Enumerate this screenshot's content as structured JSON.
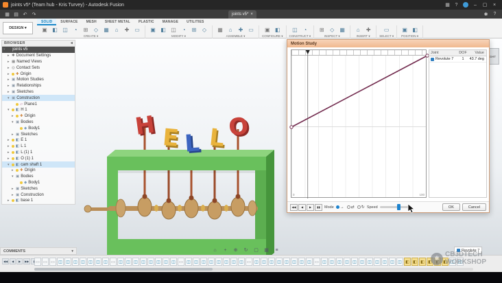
{
  "window": {
    "title": "joints v5* (Team hub - Kris Turvey) - Autodesk Fusion",
    "right_icons": [
      "▦",
      "?"
    ],
    "controls": {
      "minimize": "–",
      "maximize": "▢",
      "close": "×"
    }
  },
  "topbar": {
    "left_icons": [
      "▦",
      "▤",
      "↶",
      "↷"
    ],
    "tab": {
      "label": "joints v5*",
      "close": "×"
    },
    "right_icons": [
      "✱",
      "?"
    ]
  },
  "ribbon": {
    "design_label": "DESIGN ▾",
    "tabs": [
      {
        "label": "SOLID",
        "active": true
      },
      {
        "label": "SURFACE",
        "active": false
      },
      {
        "label": "MESH",
        "active": false
      },
      {
        "label": "SHEET METAL",
        "active": false
      },
      {
        "label": "PLASTIC",
        "active": false
      },
      {
        "label": "MANAGE",
        "active": false
      },
      {
        "label": "UTILITIES",
        "active": false
      }
    ],
    "groups": [
      {
        "label": "CREATE",
        "icons": 10
      },
      {
        "label": "MODIFY",
        "icons": 6
      },
      {
        "label": "ASSEMBLE",
        "icons": 4
      },
      {
        "label": "CONFIGURE",
        "icons": 2
      },
      {
        "label": "CONSTRUCT",
        "icons": 2
      },
      {
        "label": "INSPECT",
        "icons": 3
      },
      {
        "label": "INSERT",
        "icons": 2
      },
      {
        "label": "SELECT",
        "icons": 1
      },
      {
        "label": "POSITION",
        "icons": 2
      }
    ]
  },
  "browser": {
    "header": "BROWSER",
    "tree": [
      {
        "label": "joints v5",
        "d": 0,
        "t": "doc",
        "c": 2,
        "sel": "dark"
      },
      {
        "label": "Document Settings",
        "d": 1,
        "t": "gear",
        "c": 1
      },
      {
        "label": "Named Views",
        "d": 1,
        "t": "views",
        "c": 1
      },
      {
        "label": "Contact Sets",
        "d": 1,
        "t": "contact",
        "c": 1
      },
      {
        "label": "Origin",
        "d": 1,
        "t": "origin",
        "c": 1,
        "b": 1
      },
      {
        "label": "Motion Studies",
        "d": 1,
        "t": "folder",
        "c": 1
      },
      {
        "label": "Relationships",
        "d": 1,
        "t": "folder",
        "c": 1
      },
      {
        "label": "Sketches",
        "d": 1,
        "t": "folder",
        "c": 1
      },
      {
        "label": "Construction",
        "d": 1,
        "t": "folder",
        "c": 2,
        "sel": "blue"
      },
      {
        "label": "Plane1",
        "d": 2,
        "t": "plane",
        "c": 0,
        "b": 1
      },
      {
        "label": "H 1",
        "d": 1,
        "t": "comp",
        "c": 2,
        "b": 1
      },
      {
        "label": "Origin",
        "d": 2,
        "t": "origin",
        "c": 1,
        "b": 1
      },
      {
        "label": "Bodies",
        "d": 2,
        "t": "folder",
        "c": 2
      },
      {
        "label": "Body1",
        "d": 3,
        "t": "body",
        "c": 0,
        "b": 1
      },
      {
        "label": "Sketches",
        "d": 2,
        "t": "folder",
        "c": 1
      },
      {
        "label": "E 1",
        "d": 1,
        "t": "comp",
        "c": 1,
        "b": 1
      },
      {
        "label": "L 1",
        "d": 1,
        "t": "comp",
        "c": 1,
        "b": 1
      },
      {
        "label": "L (1) 1",
        "d": 1,
        "t": "comp",
        "c": 1,
        "b": 1
      },
      {
        "label": "O (1) 1",
        "d": 1,
        "t": "comp",
        "c": 1,
        "b": 1
      },
      {
        "label": "cam shaft 1",
        "d": 1,
        "t": "comp",
        "c": 2,
        "b": 1,
        "sel": "blue"
      },
      {
        "label": "Origin",
        "d": 2,
        "t": "origin",
        "c": 1,
        "b": 1
      },
      {
        "label": "Bodies",
        "d": 2,
        "t": "folder",
        "c": 2
      },
      {
        "label": "Body1",
        "d": 3,
        "t": "body",
        "c": 0,
        "b": 1
      },
      {
        "label": "Sketches",
        "d": 2,
        "t": "folder",
        "c": 1
      },
      {
        "label": "Construction",
        "d": 2,
        "t": "folder",
        "c": 1
      },
      {
        "label": "base 1",
        "d": 1,
        "t": "comp",
        "c": 1,
        "b": 1
      }
    ]
  },
  "viewport": {
    "letters": [
      {
        "ch": "H",
        "color": "#c8423a",
        "shadow": "#8e2a25"
      },
      {
        "ch": "E",
        "color": "#e9b33c",
        "shadow": "#a87f21"
      },
      {
        "ch": "L",
        "color": "#3c64c0",
        "shadow": "#27458c"
      },
      {
        "ch": "L",
        "color": "#e9b33c",
        "shadow": "#a87f21"
      },
      {
        "ch": "O",
        "color": "#c8423a",
        "shadow": "#8e2a25"
      }
    ],
    "model_colors": {
      "frame": "#69c05c",
      "wood": "#c79d63"
    },
    "navbar_icons": [
      "⌂",
      "+",
      "⊕",
      "↻",
      "▢",
      "▦",
      "≡"
    ],
    "viewcube_label": "RIGHT"
  },
  "motion_study": {
    "title": "Motion Study",
    "table": {
      "headers": [
        "Joint",
        "DOF",
        "Value"
      ],
      "rows": [
        {
          "joint": "Revolute 7",
          "dof": "1",
          "value": "43.7 deg"
        }
      ]
    },
    "transport": [
      "◀◀",
      "◀",
      "▶",
      "▮▮"
    ],
    "mode_label": "Mode",
    "modes": [
      "→",
      "⇄",
      "↻"
    ],
    "speed_label": "Speed",
    "ok_label": "OK",
    "cancel_label": "Cancel",
    "x_min_label": "0",
    "x_max_label": "100"
  },
  "chart_data": {
    "type": "line",
    "title": "Motion Study",
    "series": [
      {
        "name": "Revolute 7",
        "x": [
          0,
          100
        ],
        "y": [
          0,
          360
        ]
      }
    ],
    "xlim": [
      0,
      100
    ],
    "ylim": [
      -360,
      360
    ],
    "x_ticks": [
      "0",
      "100"
    ],
    "current_step": 12,
    "current_value": "43.7 deg",
    "line_color": "#722b4e",
    "grid": true,
    "legend": "none"
  },
  "bottom": {
    "comments_label": "COMMENTS",
    "revolute_label": "Revolute 7",
    "transport": [
      "◀◀",
      "◀",
      "▶",
      "▶▶",
      "▮"
    ],
    "timeline_icons": "gggtttttttgttttttttgttttttttgttttttttgtttttttttttyyyyyytt"
  },
  "watermark": {
    "line1": "CB3DTECH",
    "line2": "WORKSHOP"
  }
}
